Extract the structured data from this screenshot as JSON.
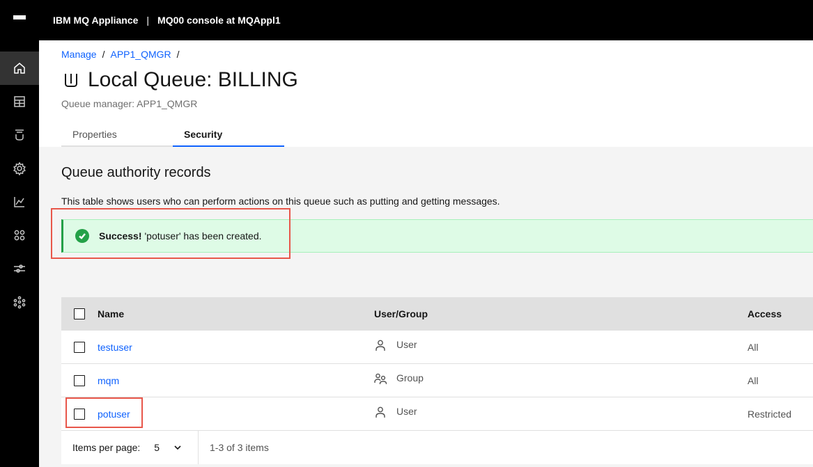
{
  "header": {
    "product": "IBM MQ Appliance",
    "separator": "|",
    "console": "MQ00 console at MQAppl1"
  },
  "sidebar": {
    "items": [
      {
        "icon": "home-icon"
      },
      {
        "icon": "table-icon"
      },
      {
        "icon": "queue-icon"
      },
      {
        "icon": "gear-icon"
      },
      {
        "icon": "chart-icon"
      },
      {
        "icon": "apps-icon"
      },
      {
        "icon": "sliders-icon"
      },
      {
        "icon": "network-icon"
      }
    ]
  },
  "breadcrumb": {
    "items": [
      "Manage",
      "APP1_QMGR"
    ],
    "separator": "/"
  },
  "page": {
    "title": "Local Queue: BILLING",
    "subtitle": "Queue manager: APP1_QMGR",
    "tabs": [
      {
        "label": "Properties",
        "active": false
      },
      {
        "label": "Security",
        "active": true
      }
    ]
  },
  "section": {
    "title": "Queue authority records",
    "description": "This table shows users who can perform actions on this queue such as putting and getting messages."
  },
  "notification": {
    "strong": "Success!",
    "message": "'potuser' has been created."
  },
  "table": {
    "headers": {
      "name": "Name",
      "type": "User/Group",
      "access": "Access"
    },
    "rows": [
      {
        "name": "testuser",
        "type": "User",
        "type_icon": "user-icon",
        "access": "All"
      },
      {
        "name": "mqm",
        "type": "Group",
        "type_icon": "group-icon",
        "access": "All"
      },
      {
        "name": "potuser",
        "type": "User",
        "type_icon": "user-icon",
        "access": "Restricted"
      }
    ]
  },
  "pagination": {
    "label": "Items per page:",
    "value": "5",
    "range": "1-3 of 3 items"
  },
  "colors": {
    "accent": "#0f62fe",
    "success": "#24a148",
    "highlight": "#e8564a"
  }
}
